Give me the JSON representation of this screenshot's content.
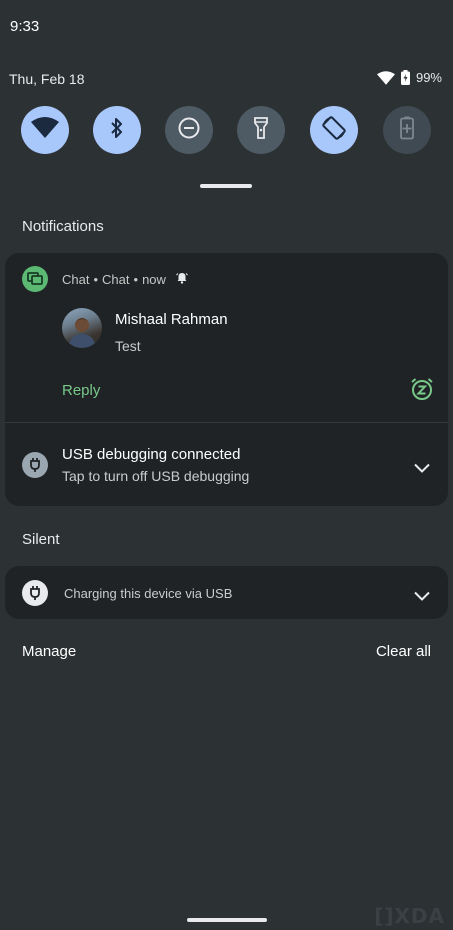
{
  "status_bar": {
    "time": "9:33",
    "date": "Thu, Feb 18",
    "battery": "99%"
  },
  "quick_settings": [
    {
      "icon": "wifi-icon",
      "state": "on"
    },
    {
      "icon": "bluetooth-icon",
      "state": "on"
    },
    {
      "icon": "do-not-disturb-icon",
      "state": "off"
    },
    {
      "icon": "flashlight-icon",
      "state": "off"
    },
    {
      "icon": "auto-rotate-icon",
      "state": "on"
    },
    {
      "icon": "battery-saver-icon",
      "state": "unavailable"
    }
  ],
  "notifications_header": "Notifications",
  "chat_notification": {
    "app": "Chat",
    "channel": "Chat",
    "time": "now",
    "sender": "Mishaal Rahman",
    "message": "Test",
    "action": "Reply",
    "accent_color": "#78c989"
  },
  "usb_notification": {
    "title": "USB debugging connected",
    "subtitle": "Tap to turn off USB debugging"
  },
  "silent_header": "Silent",
  "silent_notification": {
    "text": "Charging this device via USB"
  },
  "footer": {
    "manage": "Manage",
    "clear_all": "Clear all"
  },
  "watermark": "[]XDA"
}
